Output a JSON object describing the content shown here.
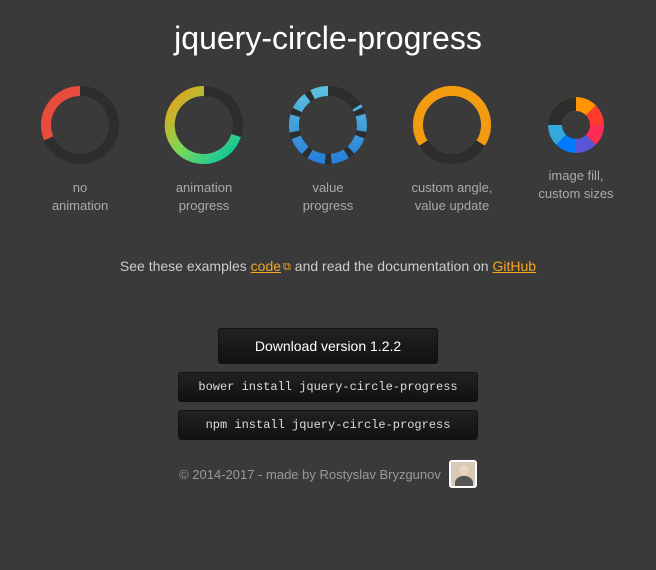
{
  "title": "jquery-circle-progress",
  "circles": [
    {
      "caption": "no\nanimation"
    },
    {
      "caption": "animation\nprogress"
    },
    {
      "caption": "value\nprogress"
    },
    {
      "caption": "custom angle,\nvalue update"
    },
    {
      "caption": "image fill,\ncustom sizes"
    }
  ],
  "info": {
    "prefix": "See these examples ",
    "code_link": "code",
    "middle": " and read the documentation on ",
    "github_link": "GitHub"
  },
  "buttons": {
    "download": "Download version 1.2.2",
    "bower": "bower install jquery-circle-progress",
    "npm": "npm install jquery-circle-progress"
  },
  "footer": {
    "text": "© 2014-2017 - made by Rostyslav Bryzgunov"
  }
}
